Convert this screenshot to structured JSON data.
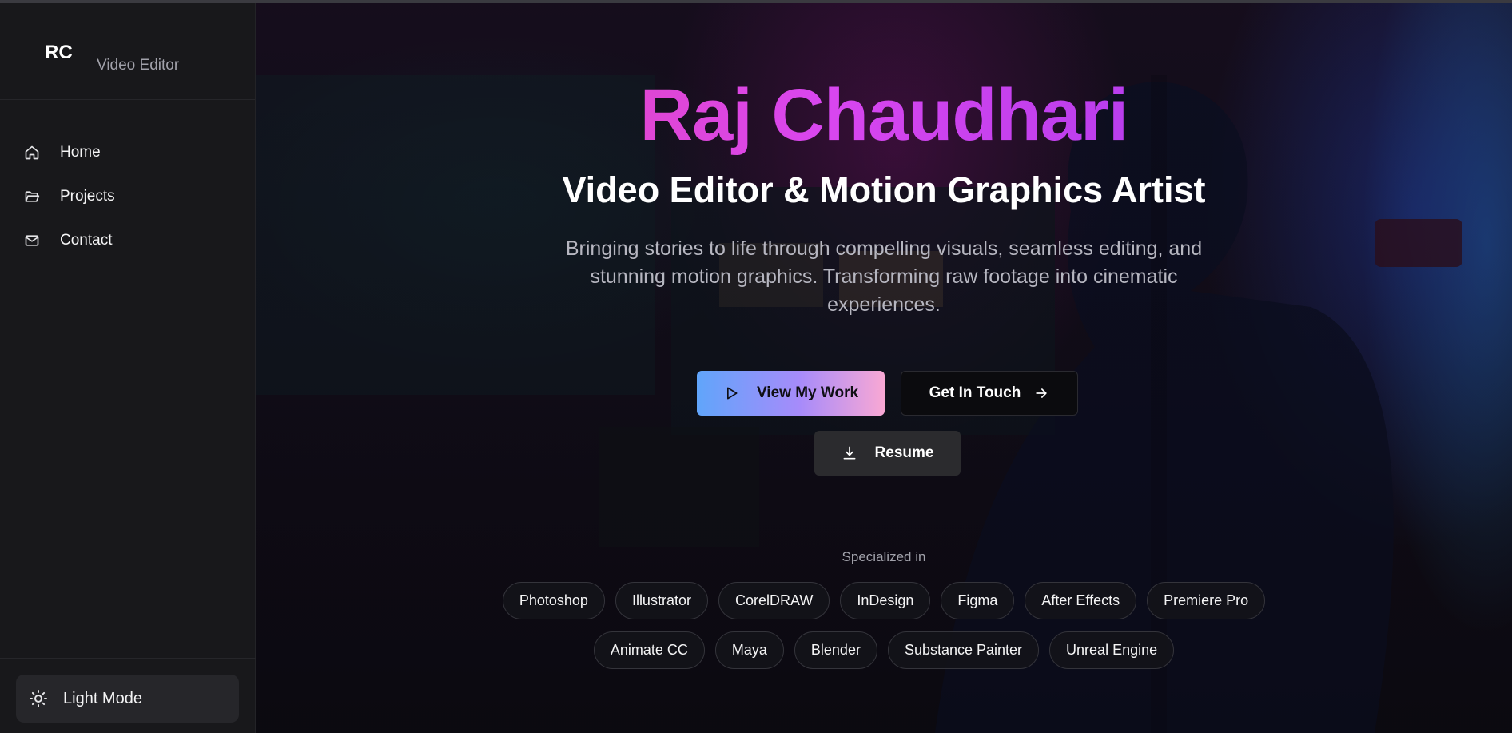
{
  "sidebar": {
    "logo": "RC",
    "subtitle": "Video Editor",
    "nav": [
      {
        "label": "Home",
        "icon": "home-icon"
      },
      {
        "label": "Projects",
        "icon": "folder-open-icon"
      },
      {
        "label": "Contact",
        "icon": "mail-icon"
      }
    ],
    "theme_toggle": {
      "label": "Light Mode",
      "icon": "sun-icon"
    }
  },
  "hero": {
    "name": "Raj Chaudhari",
    "role": "Video Editor & Motion Graphics Artist",
    "description": "Bringing stories to life through compelling visuals, seamless editing, and stunning motion graphics. Transforming raw footage into cinematic experiences.",
    "buttons": {
      "view_work": {
        "label": "View My Work",
        "icon": "play-icon"
      },
      "get_in_touch": {
        "label": "Get In Touch",
        "icon": "arrow-right-icon"
      },
      "resume": {
        "label": "Resume",
        "icon": "download-icon"
      }
    },
    "specialized_label": "Specialized in",
    "skills_row1": [
      "Photoshop",
      "Illustrator",
      "CorelDRAW",
      "InDesign",
      "Figma",
      "After Effects",
      "Premiere Pro"
    ],
    "skills_row2": [
      "Animate CC",
      "Maya",
      "Blender",
      "Substance Painter",
      "Unreal Engine"
    ]
  },
  "colors": {
    "name_gradient": [
      "#ec4899",
      "#d946ef",
      "#9333ea"
    ],
    "primary_button_gradient": [
      "#60a5fa",
      "#a78bfa",
      "#f9a8d4"
    ],
    "sidebar_bg": "#18181b"
  }
}
